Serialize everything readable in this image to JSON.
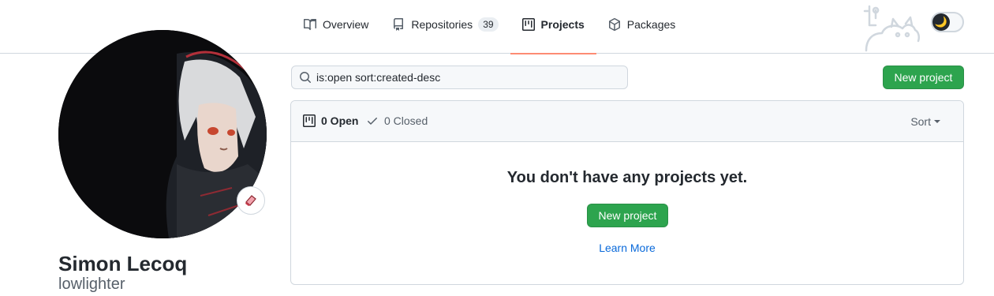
{
  "nav": {
    "tabs": [
      {
        "label": "Overview",
        "icon": "book-icon"
      },
      {
        "label": "Repositories",
        "icon": "repo-icon",
        "count": "39"
      },
      {
        "label": "Projects",
        "icon": "project-icon",
        "active": true
      },
      {
        "label": "Packages",
        "icon": "package-icon"
      }
    ]
  },
  "theme_toggle": {
    "icon": "moon-icon",
    "glyph": "🌙"
  },
  "profile": {
    "full_name": "Simon Lecoq",
    "username": "lowlighter",
    "status_icon": "eraser-icon"
  },
  "search": {
    "value": "is:open sort:created-desc"
  },
  "toolbar": {
    "new_project_label": "New project"
  },
  "projects": {
    "open_label": "0 Open",
    "closed_label": "0 Closed",
    "sort_label": "Sort",
    "blank_title": "You don't have any projects yet.",
    "new_project_label": "New project",
    "learn_more_label": "Learn More"
  },
  "colors": {
    "primary_button": "#2da44e",
    "active_tab_underline": "#fd8c73",
    "link": "#0969da"
  }
}
